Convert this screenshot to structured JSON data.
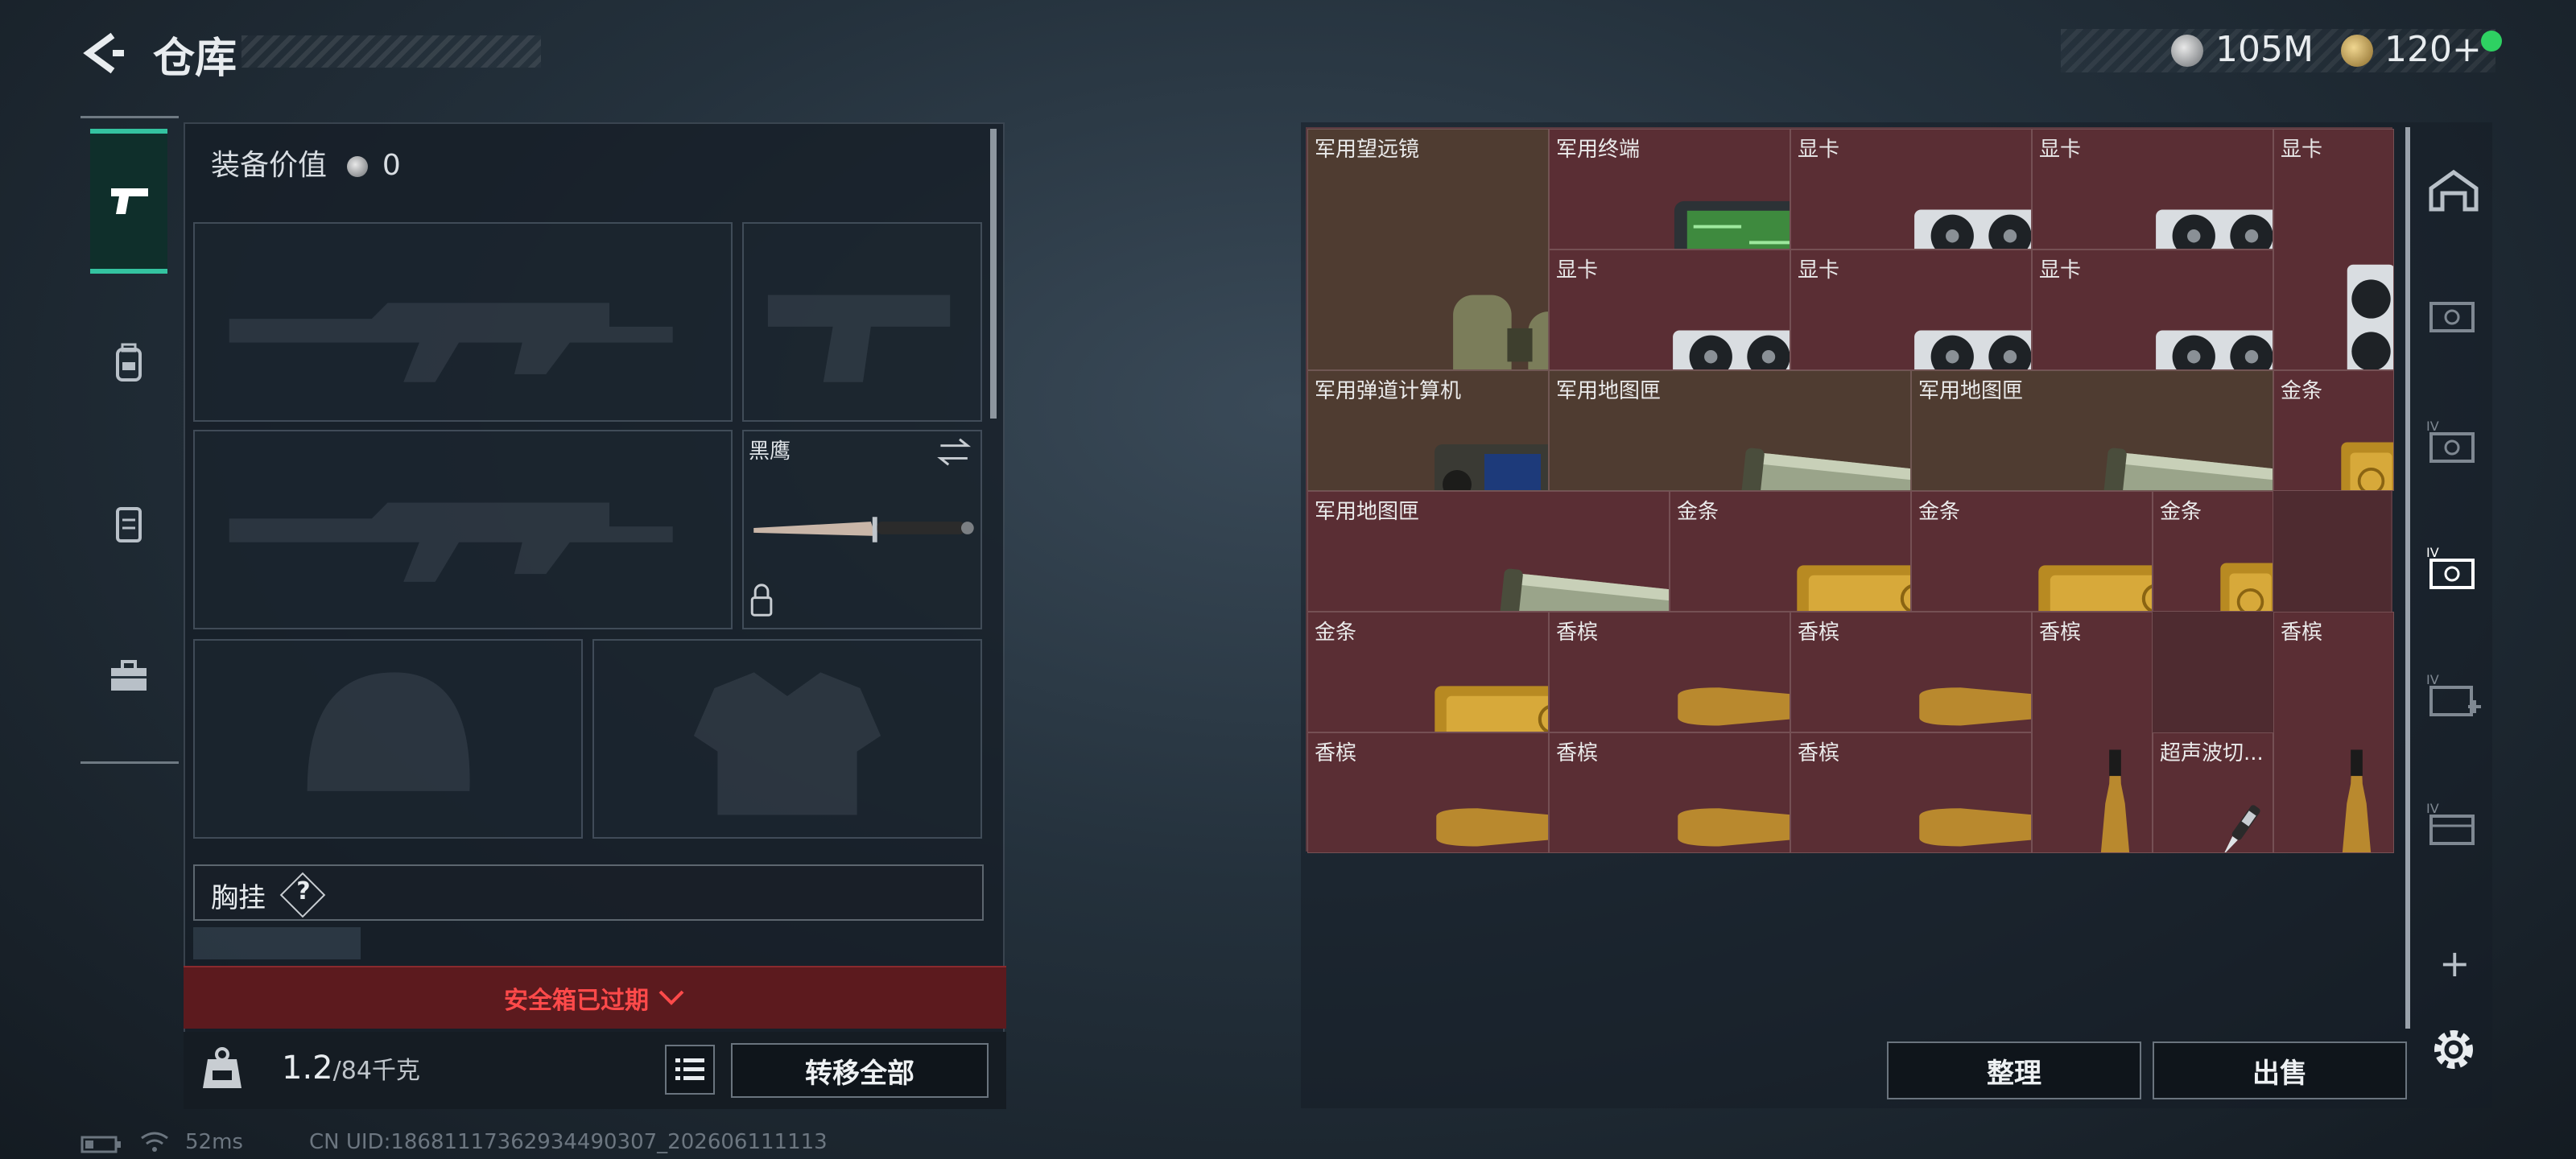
{
  "header": {
    "title": "仓库",
    "silver": "105M",
    "gold": "120+"
  },
  "equipment": {
    "value_label": "装备价值",
    "value": "0",
    "knife_name": "黑鹰",
    "chest_label": "胸挂",
    "chest_help": "?",
    "safebox_status": "安全箱已过期",
    "weight_current": "1.2",
    "weight_max": "/84千克",
    "transfer_all": "转移全部"
  },
  "warehouse": {
    "cells": [
      {
        "label": "军用望远镜",
        "icon": "binoculars-icon"
      },
      {
        "label": "军用终端",
        "icon": "terminal-icon"
      },
      {
        "label": "显卡",
        "icon": "gpu-icon"
      },
      {
        "label": "显卡",
        "icon": "gpu-icon"
      },
      {
        "label": "显卡",
        "icon": "gpu-vertical-icon"
      },
      {
        "label": "显卡",
        "icon": "gpu-icon"
      },
      {
        "label": "显卡",
        "icon": "gpu-icon"
      },
      {
        "label": "显卡",
        "icon": "gpu-icon"
      },
      {
        "label": "军用弹道计算机",
        "icon": "ballistic-computer-icon"
      },
      {
        "label": "军用地图匣",
        "icon": "map-tube-icon"
      },
      {
        "label": "军用地图匣",
        "icon": "map-tube-icon"
      },
      {
        "label": "金条",
        "icon": "gold-bar-vertical-icon"
      },
      {
        "label": "军用地图匣",
        "icon": "map-tube-icon"
      },
      {
        "label": "金条",
        "icon": "gold-bar-icon"
      },
      {
        "label": "金条",
        "icon": "gold-bar-icon"
      },
      {
        "label": "金条",
        "icon": "gold-bar-vertical-icon"
      },
      {
        "label": "金条",
        "icon": "gold-bar-icon"
      },
      {
        "label": "香槟",
        "icon": "champagne-icon"
      },
      {
        "label": "香槟",
        "icon": "champagne-icon"
      },
      {
        "label": "香槟",
        "icon": "champagne-vertical-icon"
      },
      {
        "label": "香槟",
        "icon": "champagne-vertical-icon"
      },
      {
        "label": "香槟",
        "icon": "champagne-icon"
      },
      {
        "label": "香槟",
        "icon": "champagne-icon"
      },
      {
        "label": "香槟",
        "icon": "champagne-icon"
      },
      {
        "label": "超声波切...",
        "icon": "ultrasonic-cutter-icon"
      }
    ],
    "sort_label": "整理",
    "sell_label": "出售",
    "add_label": "+"
  },
  "status": {
    "ping": "52ms",
    "uid": "CN UID:18681117362934490307_202606111113"
  },
  "colors": {
    "accent": "#34c3a0",
    "expired": "#ff4a4a",
    "item_cell": "#5a2e34",
    "online": "#2ed162"
  }
}
